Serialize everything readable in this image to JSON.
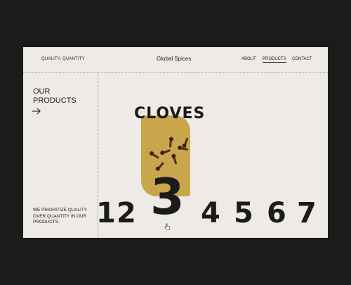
{
  "header": {
    "tagline": "QUALITY, QUANTITY",
    "brand": "Global Spices",
    "nav": [
      {
        "label": "ABOUT",
        "active": false
      },
      {
        "label": "PRODUCTS",
        "active": true
      },
      {
        "label": "CONTACT",
        "active": false
      }
    ]
  },
  "sidebar": {
    "title_line1": "OUR",
    "title_line2": "PRODUCTS",
    "arrow_icon": "arrow-right-icon",
    "blurb": "WE PRIORITIZE QUALITY OVER QUANTITY IN OUR PRODUCTS."
  },
  "product": {
    "name": "CLOVES",
    "image_color": "#c9a64b"
  },
  "selector": {
    "numbers": [
      "1",
      "2",
      "3",
      "4",
      "5",
      "6",
      "7"
    ],
    "active": "3"
  },
  "colors": {
    "background": "#1c1b1b",
    "page": "#eeebe6",
    "text": "#1c1b1b",
    "accent": "#c9a64b"
  }
}
